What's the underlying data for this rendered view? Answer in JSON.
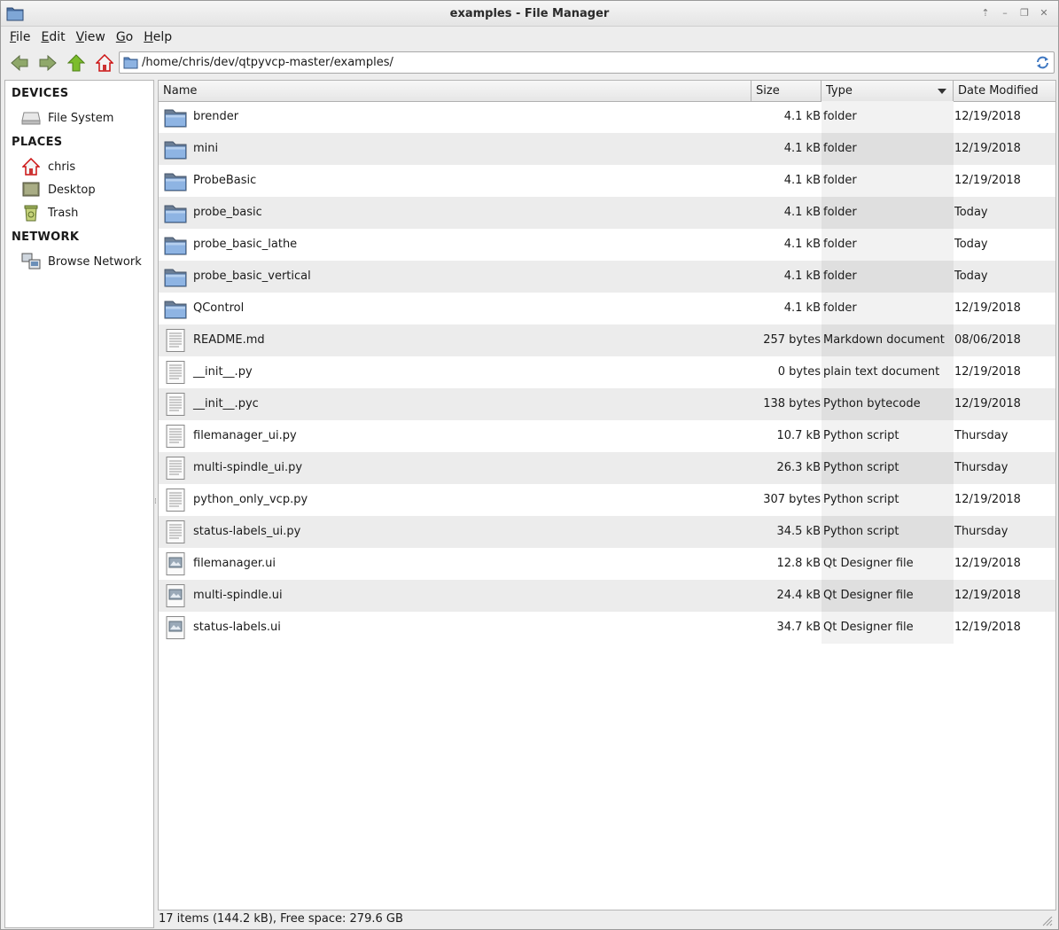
{
  "window": {
    "title": "examples - File Manager"
  },
  "menubar": {
    "items": [
      {
        "label": "File",
        "mnemonic": "F",
        "rest": "ile"
      },
      {
        "label": "Edit",
        "mnemonic": "E",
        "rest": "dit"
      },
      {
        "label": "View",
        "mnemonic": "V",
        "rest": "iew"
      },
      {
        "label": "Go",
        "mnemonic": "G",
        "rest": "o"
      },
      {
        "label": "Help",
        "mnemonic": "H",
        "rest": "elp"
      }
    ]
  },
  "toolbar": {
    "back_icon": "back-arrow-icon",
    "forward_icon": "forward-arrow-icon",
    "up_icon": "up-arrow-icon",
    "home_icon": "home-icon",
    "path": "/home/chris/dev/qtpyvcp-master/examples/",
    "reload_icon": "reload-icon"
  },
  "sidebar": {
    "devices_header": "DEVICES",
    "devices": [
      {
        "label": "File System",
        "icon": "drive-icon"
      }
    ],
    "places_header": "PLACES",
    "places": [
      {
        "label": "chris",
        "icon": "home-folder-icon"
      },
      {
        "label": "Desktop",
        "icon": "desktop-icon"
      },
      {
        "label": "Trash",
        "icon": "trash-icon"
      }
    ],
    "network_header": "NETWORK",
    "network": [
      {
        "label": "Browse Network",
        "icon": "network-icon"
      }
    ]
  },
  "columns": {
    "name": "Name",
    "size": "Size",
    "type": "Type",
    "date": "Date Modified"
  },
  "files": [
    {
      "name": "brender",
      "size": "4.1 kB",
      "type": "folder",
      "date": "12/19/2018",
      "kind": "folder"
    },
    {
      "name": "mini",
      "size": "4.1 kB",
      "type": "folder",
      "date": "12/19/2018",
      "kind": "folder"
    },
    {
      "name": "ProbeBasic",
      "size": "4.1 kB",
      "type": "folder",
      "date": "12/19/2018",
      "kind": "folder"
    },
    {
      "name": "probe_basic",
      "size": "4.1 kB",
      "type": "folder",
      "date": "Today",
      "kind": "folder"
    },
    {
      "name": "probe_basic_lathe",
      "size": "4.1 kB",
      "type": "folder",
      "date": "Today",
      "kind": "folder"
    },
    {
      "name": "probe_basic_vertical",
      "size": "4.1 kB",
      "type": "folder",
      "date": "Today",
      "kind": "folder"
    },
    {
      "name": "QControl",
      "size": "4.1 kB",
      "type": "folder",
      "date": "12/19/2018",
      "kind": "folder"
    },
    {
      "name": "README.md",
      "size": "257 bytes",
      "type": "Markdown document",
      "date": "08/06/2018",
      "kind": "text"
    },
    {
      "name": "__init__.py",
      "size": "0 bytes",
      "type": "plain text document",
      "date": "12/19/2018",
      "kind": "text"
    },
    {
      "name": "__init__.pyc",
      "size": "138 bytes",
      "type": "Python bytecode",
      "date": "12/19/2018",
      "kind": "text"
    },
    {
      "name": "filemanager_ui.py",
      "size": "10.7 kB",
      "type": "Python script",
      "date": "Thursday",
      "kind": "text"
    },
    {
      "name": "multi-spindle_ui.py",
      "size": "26.3 kB",
      "type": "Python script",
      "date": "Thursday",
      "kind": "text"
    },
    {
      "name": "python_only_vcp.py",
      "size": "307 bytes",
      "type": "Python script",
      "date": "12/19/2018",
      "kind": "text"
    },
    {
      "name": "status-labels_ui.py",
      "size": "34.5 kB",
      "type": "Python script",
      "date": "Thursday",
      "kind": "text"
    },
    {
      "name": "filemanager.ui",
      "size": "12.8 kB",
      "type": "Qt Designer file",
      "date": "12/19/2018",
      "kind": "image"
    },
    {
      "name": "multi-spindle.ui",
      "size": "24.4 kB",
      "type": "Qt Designer file",
      "date": "12/19/2018",
      "kind": "image"
    },
    {
      "name": "status-labels.ui",
      "size": "34.7 kB",
      "type": "Qt Designer file",
      "date": "12/19/2018",
      "kind": "image"
    }
  ],
  "status": {
    "text": "17 items (144.2 kB), Free space: 279.6 GB"
  }
}
